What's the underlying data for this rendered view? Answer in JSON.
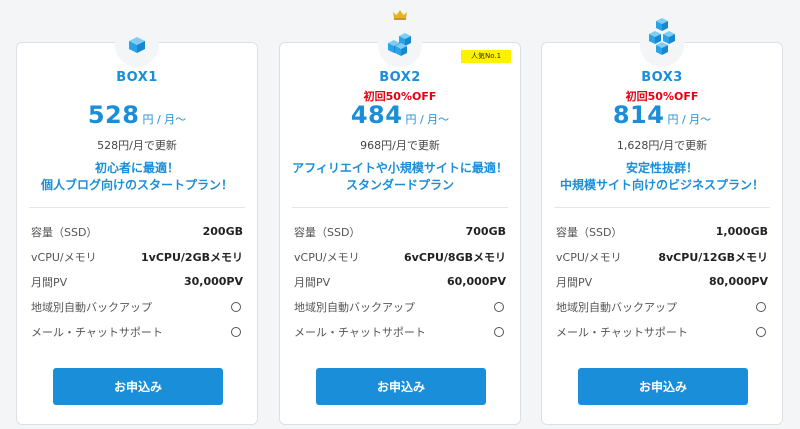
{
  "colors": {
    "accent_blue": "#1a8ed8",
    "promo_red": "#e60012",
    "badge_yellow": "#fff100",
    "background": "#f4f5f7"
  },
  "plans": [
    {
      "icon": "single-cube-icon",
      "name": "BOX1",
      "promo": "",
      "badge": "",
      "price": "528",
      "price_unit": "円 / 月～",
      "renewal": "528円/月で更新",
      "catch_line1": "初心者に最適！",
      "catch_line2": "個人ブログ向けのスタートプラン！",
      "specs": {
        "storage_label": "容量（SSD）",
        "storage_value": "200GB",
        "cpu_label": "vCPU/メモリ",
        "cpu_value": "1vCPU/2GBメモリ",
        "pv_label": "月間PV",
        "pv_value": "30,000PV",
        "backup_label": "地域別自動バックアップ",
        "support_label": "メール・チャットサポート"
      },
      "button": "お申込み"
    },
    {
      "icon": "double-cube-icon",
      "name": "BOX2",
      "promo": "初回50%OFF",
      "badge": "人気No.1",
      "price": "484",
      "price_unit": "円 / 月～",
      "renewal": "968円/月で更新",
      "catch_line1": "アフィリエイトや小規模サイトに最適！",
      "catch_line2": "スタンダードプラン",
      "specs": {
        "storage_label": "容量（SSD）",
        "storage_value": "700GB",
        "cpu_label": "vCPU/メモリ",
        "cpu_value": "6vCPU/8GBメモリ",
        "pv_label": "月間PV",
        "pv_value": "60,000PV",
        "backup_label": "地域別自動バックアップ",
        "support_label": "メール・チャットサポート"
      },
      "button": "お申込み"
    },
    {
      "icon": "stacked-cubes-icon",
      "name": "BOX3",
      "promo": "初回50%OFF",
      "badge": "",
      "price": "814",
      "price_unit": "円 / 月～",
      "renewal": "1,628円/月で更新",
      "catch_line1": "安定性抜群！",
      "catch_line2": "中規模サイト向けのビジネスプラン！",
      "specs": {
        "storage_label": "容量（SSD）",
        "storage_value": "1,000GB",
        "cpu_label": "vCPU/メモリ",
        "cpu_value": "8vCPU/12GBメモリ",
        "pv_label": "月間PV",
        "pv_value": "80,000PV",
        "backup_label": "地域別自動バックアップ",
        "support_label": "メール・チャットサポート"
      },
      "button": "お申込み"
    }
  ]
}
